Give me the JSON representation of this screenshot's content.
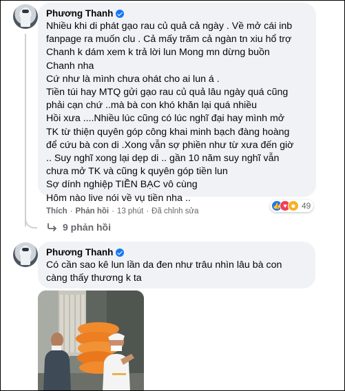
{
  "comments": [
    {
      "author": "Phương Thanh",
      "lines": [
        "Nhiều khi di phát gạo rau củ quả cả ngày . Về mở cái inb",
        "fanpage ra muốn clu . Cả mấy trăm cả ngàn tn xiu hổ trợ",
        "Chanh k dám xem k trả lời lun Mong mn dừng buồn",
        "Chanh nha",
        "Cứ như là mình chưa ohát cho ai lun á .",
        "Tiền túi hay MTQ gửi gạo rau củ quả lâu ngày quá cũng",
        "phải cạn chứ ..mà bà con khó khăn lại quá nhiều",
        "Hồi xưa ....Nhiều lúc cũng có lúc nghĩ đại hay mình mở",
        "TK từ thiện quyên góp công khai minh bạch đàng hoàng",
        "để cứu bà con di .Xong vẫn sợ phiền như từ xưa đến giờ",
        ".. Suy nghĩ xong lại dẹp di .. gần 10 năm suy nghĩ vẫn",
        "chưa mở TK và cũng k quyên góp tiền lun",
        "Sợ dính nghiệp TIỀN BẠC vô cùng",
        "Hôm nào live nói về vụ tiền nha .."
      ],
      "actions": {
        "like": "Thích",
        "reply": "Phản hồi",
        "time": "13 phút",
        "edited": "Đã chỉnh sửa",
        "separator": "·"
      },
      "reactions": {
        "icons": [
          "like-icon",
          "love-icon",
          "care-icon"
        ],
        "count": "49"
      },
      "replies_label": "9 phản hồi"
    },
    {
      "author": "Phương Thanh",
      "lines": [
        "Có cần sao kê lun lần da đen như trâu nhìn lâu bà con",
        "càng thấy thương k ta"
      ]
    }
  ],
  "colors": {
    "bubble": "#f0f2f5",
    "verified": "#1877f2",
    "meta_text": "#65676b",
    "like": "#1877f2",
    "love": "#f33e58",
    "care": "#f7b125"
  }
}
